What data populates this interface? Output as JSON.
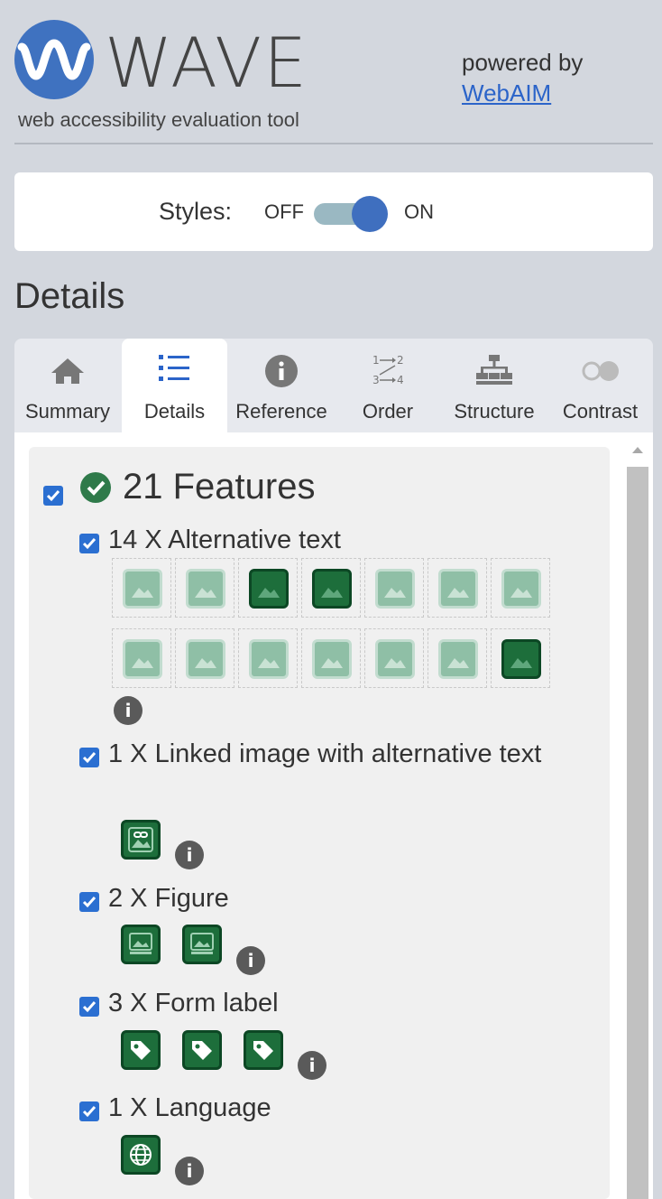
{
  "header": {
    "logo_text": "WAVE",
    "tagline": "web accessibility evaluation tool",
    "powered_by": "powered by",
    "webaim_link": "WebAIM"
  },
  "styles_toggle": {
    "label": "Styles:",
    "off_label": "OFF",
    "on_label": "ON",
    "state": "on"
  },
  "section_title": "Details",
  "tabs": [
    {
      "label": "Summary",
      "icon": "home-icon",
      "active": false
    },
    {
      "label": "Details",
      "icon": "list-icon",
      "active": true
    },
    {
      "label": "Reference",
      "icon": "info-icon",
      "active": false
    },
    {
      "label": "Order",
      "icon": "order-icon",
      "active": false
    },
    {
      "label": "Structure",
      "icon": "structure-icon",
      "active": false
    },
    {
      "label": "Contrast",
      "icon": "contrast-icon",
      "active": false
    }
  ],
  "features": {
    "title": "21 Features",
    "items": [
      {
        "label": "14 X Alternative text",
        "count": 14,
        "icon": "image-alt-icon"
      },
      {
        "label": "1 X Linked image with alternative text",
        "count": 1,
        "icon": "linked-image-icon"
      },
      {
        "label": "2 X Figure",
        "count": 2,
        "icon": "figure-icon"
      },
      {
        "label": "3 X Form label",
        "count": 3,
        "icon": "label-tag-icon"
      },
      {
        "label": "1 X Language",
        "count": 1,
        "icon": "globe-icon"
      }
    ]
  },
  "colors": {
    "accent_blue": "#3f72c0",
    "feature_green": "#1d6e3b",
    "checkbox_blue": "#2b6fd1"
  }
}
